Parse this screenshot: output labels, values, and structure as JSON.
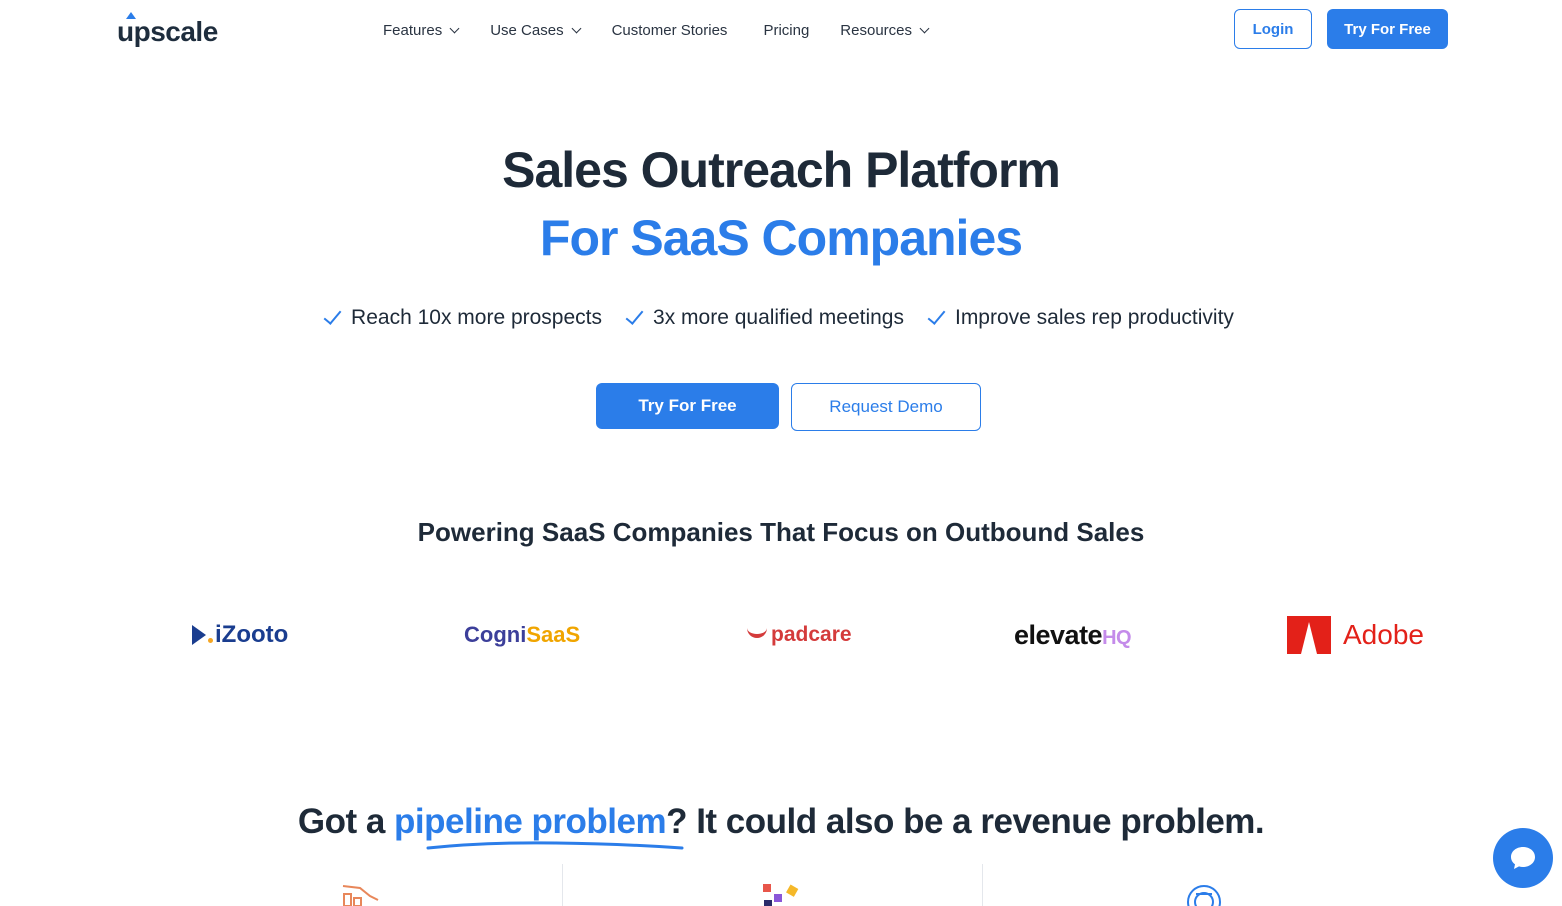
{
  "nav": {
    "logo": "upscale",
    "menu": [
      {
        "label": "Features",
        "dropdown": true
      },
      {
        "label": "Use Cases",
        "dropdown": true
      },
      {
        "label": "Customer Stories",
        "dropdown": false
      },
      {
        "label": "Pricing",
        "dropdown": false
      },
      {
        "label": "Resources",
        "dropdown": true
      }
    ],
    "login_label": "Login",
    "try_label": "Try For Free"
  },
  "hero": {
    "title_line1": "Sales Outreach Platform",
    "title_line2": "For SaaS Companies",
    "benefits": [
      "Reach 10x more prospects",
      "3x more qualified meetings",
      "Improve sales rep productivity"
    ],
    "primary_cta": "Try For Free",
    "secondary_cta": "Request Demo"
  },
  "customers": {
    "heading": "Powering SaaS Companies That Focus on Outbound Sales",
    "logos": {
      "izooto": "iZooto",
      "cogni_part1": "Cogni",
      "cogni_part2": "SaaS",
      "padcare": "padcare",
      "elevate_part1": "elevate",
      "elevate_part2": "HQ",
      "adobe": "Adobe"
    }
  },
  "pipeline": {
    "before": "Got a ",
    "highlight": "pipeline problem",
    "after": "? It could also be a revenue problem."
  },
  "colors": {
    "accent": "#2b7de9",
    "text": "#1e2a38"
  },
  "icons": {
    "chat": "chat-bubble-icon",
    "check": "check-icon",
    "chevron": "chevron-down-icon"
  }
}
